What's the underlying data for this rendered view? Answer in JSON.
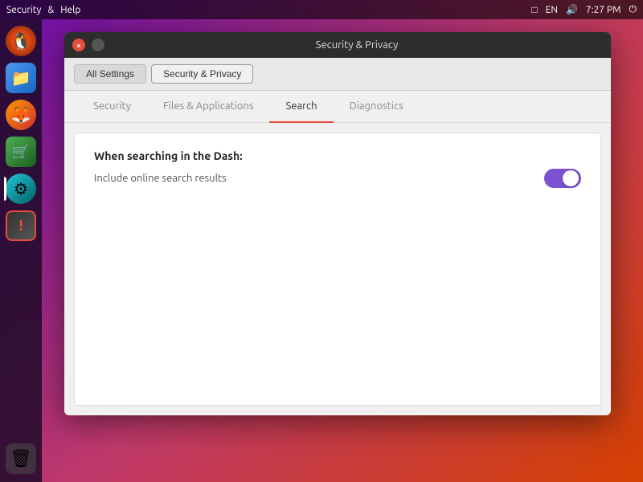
{
  "topbar": {
    "app_menu": "Security",
    "help_menu": "Help",
    "indicators": {
      "display_icon": "□",
      "language": "EN",
      "volume_icon": "🔊",
      "time": "7:27 PM",
      "power_icon": "⏻"
    }
  },
  "sidebar": {
    "items": [
      {
        "name": "ubuntu-logo",
        "icon": "🐧",
        "label": "Ubuntu"
      },
      {
        "name": "files",
        "icon": "📁",
        "label": "Files"
      },
      {
        "name": "firefox",
        "icon": "🦊",
        "label": "Firefox"
      },
      {
        "name": "software-center",
        "icon": "🛒",
        "label": "Software Center"
      },
      {
        "name": "system-settings",
        "icon": "⚙",
        "label": "System Settings"
      },
      {
        "name": "software-updater",
        "icon": "!",
        "label": "Software Updater"
      }
    ],
    "bottom_items": [
      {
        "name": "trash",
        "icon": "🗑",
        "label": "Trash"
      }
    ]
  },
  "window": {
    "title": "Security & Privacy",
    "close_btn": "×",
    "minimize_btn": "",
    "breadcrumbs": [
      {
        "label": "All Settings",
        "active": false
      },
      {
        "label": "Security & Privacy",
        "active": true
      }
    ],
    "tabs": [
      {
        "id": "security",
        "label": "Security",
        "active": false
      },
      {
        "id": "files-applications",
        "label": "Files & Applications",
        "active": false
      },
      {
        "id": "search",
        "label": "Search",
        "active": true
      },
      {
        "id": "diagnostics",
        "label": "Diagnostics",
        "active": false
      }
    ],
    "content": {
      "search_tab": {
        "section_title": "When searching in the Dash:",
        "setting_label": "Include online search results",
        "toggle_on": true
      }
    }
  }
}
